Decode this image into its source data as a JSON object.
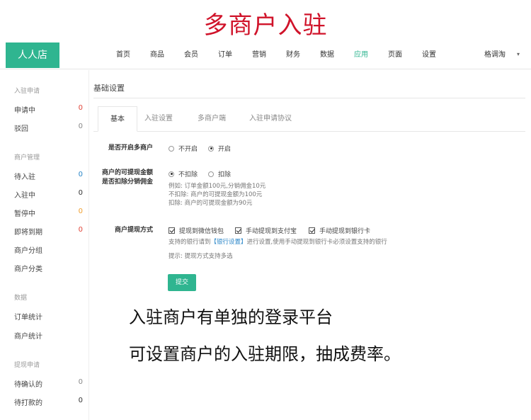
{
  "banner_title": "多商户入驻",
  "brand": "人人店",
  "colors": {
    "accent": "#2fb590",
    "banner": "#d0132a",
    "zero_red": "#e0463a",
    "zero_blue": "#2a86c8",
    "zero_orange": "#f0a030"
  },
  "nav": {
    "items": [
      "首页",
      "商品",
      "会员",
      "订单",
      "营销",
      "财务",
      "数据",
      "应用",
      "页面",
      "设置"
    ],
    "active": "应用",
    "user": "格调淘",
    "caret_icon": "caret-down-icon"
  },
  "sidebar": {
    "group_join": "入驻申请",
    "applying": {
      "label": "申请中",
      "count": "0"
    },
    "rejected": {
      "label": "驳回",
      "count": "0"
    },
    "group_merchant": "商户管理",
    "pending": {
      "label": "待入驻",
      "count": "0"
    },
    "joining": {
      "label": "入驻中",
      "count": "0"
    },
    "paused": {
      "label": "暂停中",
      "count": "0"
    },
    "expiring": {
      "label": "即将到期",
      "count": "0"
    },
    "merchant_group": "商户分组",
    "merchant_category": "商户分类",
    "group_data": "数据",
    "order_stats": "订单统计",
    "merchant_stats": "商户统计",
    "group_withdraw": "提现申请",
    "to_confirm": {
      "label": "待确认的",
      "count": "0"
    },
    "to_pay": {
      "label": "待打款的",
      "count": "0"
    }
  },
  "main": {
    "section_title": "基础设置",
    "tabs": [
      "基本",
      "入驻设置",
      "多商户端",
      "入驻申请协议"
    ],
    "enable": {
      "label": "是否开启多商户",
      "options": [
        "不开启",
        "开启"
      ],
      "selected": "开启"
    },
    "deduct": {
      "label_line1": "商户的可提现金额",
      "label_line2": "是否扣除分销佣金",
      "options": [
        "不扣除",
        "扣除"
      ],
      "selected": "不扣除",
      "help1": "例如: 订单金额100元,分销佣金10元",
      "help2": "不扣除: 商户的可提现金额为100元",
      "help3": "扣除: 商户的可提现金额为90元"
    },
    "withdraw": {
      "label": "商户提现方式",
      "options": [
        "提现到微信钱包",
        "手动提现到支付宝",
        "手动提现到银行卡"
      ],
      "help_prefix": "支持的银行请到",
      "help_link": "【银行设置】",
      "help_suffix": "进行设置,使用手动提现到银行卡必须设置支持的银行",
      "hint": "提示: 提现方式支持多选"
    },
    "submit": "提交"
  },
  "captions": {
    "line1": "入驻商户有单独的登录平台",
    "line2": "可设置商户的入驻期限，抽成费率。"
  }
}
